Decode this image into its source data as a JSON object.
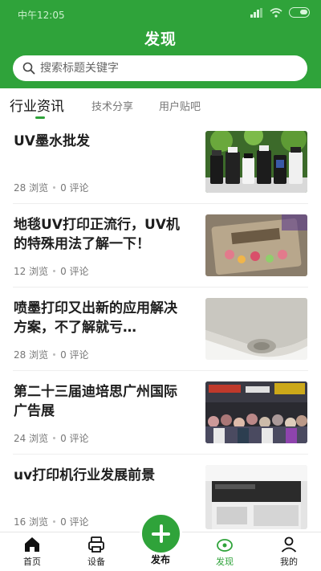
{
  "status": {
    "time": "中午12:05"
  },
  "header": {
    "title": "发现",
    "search_placeholder": "搜索标题关键字"
  },
  "tabs": [
    {
      "label": "行业资讯",
      "active": true
    },
    {
      "label": "技术分享",
      "active": false
    },
    {
      "label": "用户贴吧",
      "active": false
    }
  ],
  "articles": [
    {
      "title": "UV墨水批发",
      "views": "28 浏览",
      "comments": "0 评论",
      "thumb": "ink-bottles"
    },
    {
      "title": "地毯UV打印正流行，UV机的特殊用法了解一下！",
      "views": "12 浏览",
      "comments": "0 评论",
      "thumb": "carpet"
    },
    {
      "title": "喷墨打印又出新的应用解决方案，不了解就亏…",
      "views": "28 浏览",
      "comments": "0 评论",
      "thumb": "film-roll"
    },
    {
      "title": "第二十三届迪培思广州国际广告展",
      "views": "24 浏览",
      "comments": "0 评论",
      "thumb": "expo"
    },
    {
      "title": "uv打印机行业发展前景",
      "views": "16 浏览",
      "comments": "0 评论",
      "thumb": "printer"
    }
  ],
  "bottom_nav": {
    "home": "首页",
    "device": "设备",
    "publish": "发布",
    "discover": "发现",
    "mine": "我的",
    "active": "discover"
  },
  "colors": {
    "accent": "#2fa33a",
    "text": "#1e1e1e",
    "muted": "#777777"
  }
}
